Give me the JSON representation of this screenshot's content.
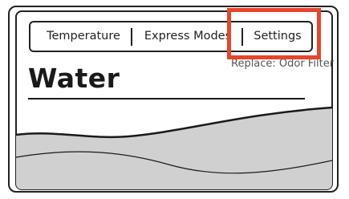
{
  "tabs": {
    "temperature": "Temperature",
    "express_modes": "Express Modes",
    "settings": "Settings"
  },
  "screen": {
    "title": "Water",
    "subtitle": "Replace: Odor Filter"
  },
  "colors": {
    "highlight": "#e8452c",
    "water_fill": "#d0d0d0",
    "outline": "#222222"
  }
}
